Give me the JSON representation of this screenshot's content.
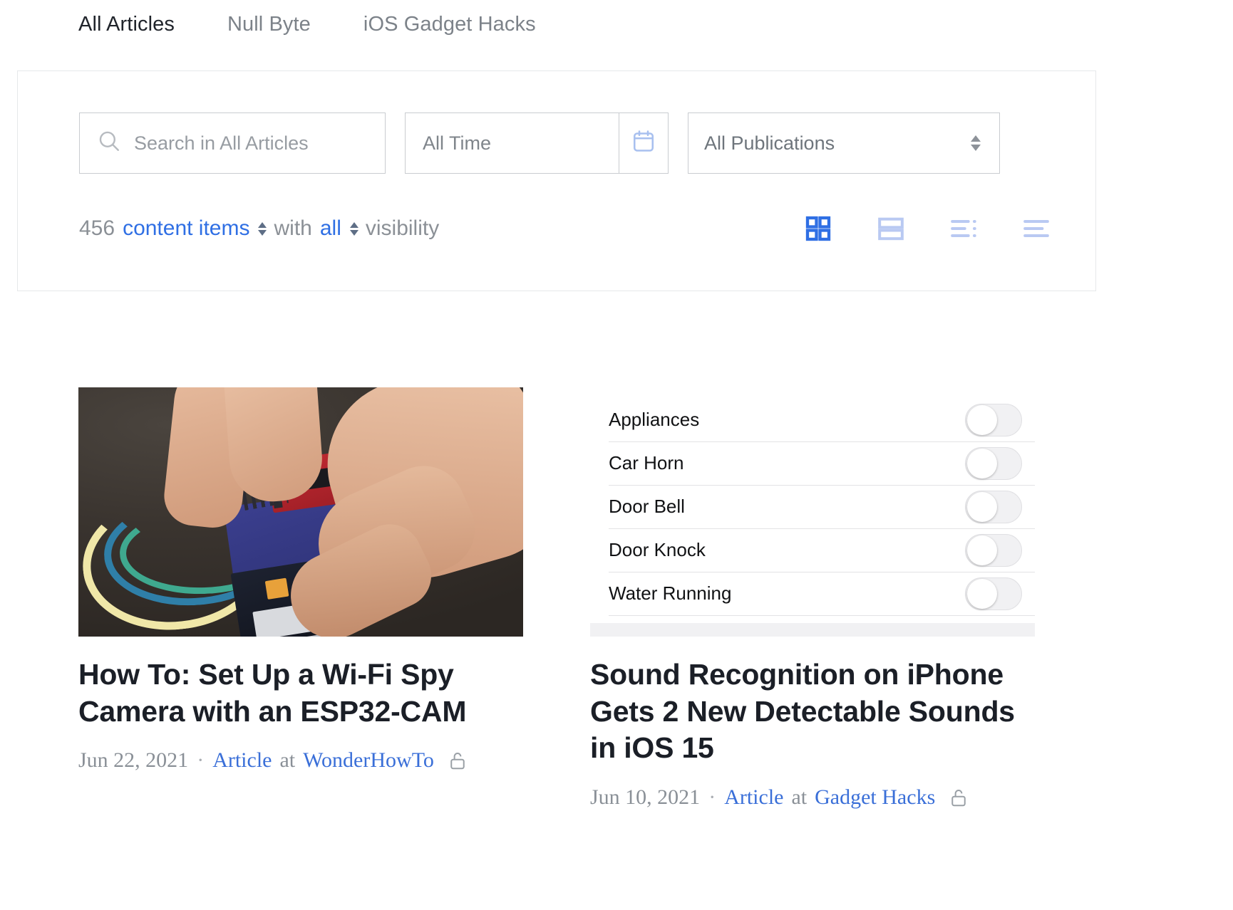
{
  "tabs": [
    {
      "label": "All Articles",
      "active": true
    },
    {
      "label": "Null Byte",
      "active": false
    },
    {
      "label": "iOS Gadget Hacks",
      "active": false
    }
  ],
  "filters": {
    "search": {
      "placeholder": "Search in All Articles",
      "value": "",
      "icon": "search-icon"
    },
    "date": {
      "value": "All Time",
      "icon": "calendar-icon"
    },
    "publications": {
      "value": "All Publications",
      "icon": "spinner-arrows-icon"
    }
  },
  "summary": {
    "count": "456",
    "count_label": "content items",
    "with": "with",
    "visibility_value": "all",
    "visibility_label": "visibility"
  },
  "view_toggles": [
    {
      "name": "grid-view-icon",
      "active": true
    },
    {
      "name": "card-view-icon",
      "active": false
    },
    {
      "name": "list-detail-view-icon",
      "active": false
    },
    {
      "name": "compact-list-view-icon",
      "active": false
    }
  ],
  "colors": {
    "accent": "#2f6fe4",
    "accent_light": "#b9c9f2",
    "link": "#3a6fd8",
    "muted": "#8b9096",
    "title": "#1b1f27"
  },
  "cards": [
    {
      "thumb_type": "photo",
      "thumb_alt": "hands wiring an ESP32-CAM on a breadboard",
      "title": "How To: Set Up a Wi-Fi Spy Camera with an ESP32-CAM",
      "date": "Jun 22, 2021",
      "separator": "·",
      "kind": "Article",
      "at": "at",
      "publication": "WonderHowTo",
      "lock": "unlocked-icon"
    },
    {
      "thumb_type": "ios-settings",
      "thumb_alt": "iOS Sound Recognition settings list with toggles",
      "ios_rows": [
        {
          "label": "Appliances",
          "on": false
        },
        {
          "label": "Car Horn",
          "on": false
        },
        {
          "label": "Door Bell",
          "on": false
        },
        {
          "label": "Door Knock",
          "on": false
        },
        {
          "label": "Water Running",
          "on": false
        }
      ],
      "title": "Sound Recognition on iPhone Gets 2 New Detectable Sounds in iOS 15",
      "date": "Jun 10, 2021",
      "separator": "·",
      "kind": "Article",
      "at": "at",
      "publication": "Gadget Hacks",
      "lock": "unlocked-icon"
    }
  ]
}
